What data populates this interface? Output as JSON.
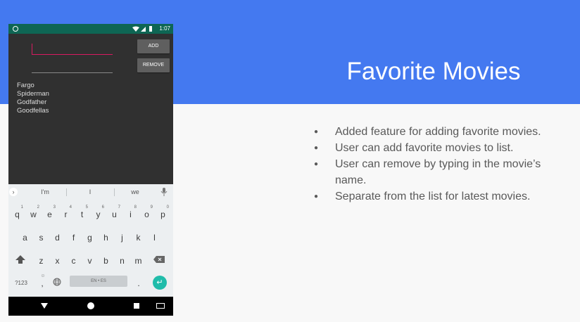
{
  "slide": {
    "title": "Favorite Movies",
    "bullets": [
      "Added feature for adding favorite movies.",
      "User can add favorite movies to list.",
      "User can remove by typing in the movie’s name.",
      "Separate from the list for latest movies."
    ],
    "colors": {
      "header": "#4479f0",
      "background": "#f8f8f8",
      "bullet_text": "#595959"
    }
  },
  "phone": {
    "status": {
      "time": "1:07",
      "icons": [
        "wifi-icon",
        "signal-icon",
        "battery-icon"
      ]
    },
    "app": {
      "add_button": "ADD",
      "remove_button": "REMOVE",
      "add_input_value": "",
      "remove_input_value": "",
      "movies": [
        "Fargo",
        "Spiderman",
        "Godfather",
        "Goodfellas"
      ],
      "colors": {
        "accent": "#d81b60",
        "background": "#303030",
        "button": "#5f5f5f"
      }
    },
    "keyboard": {
      "suggestions": [
        "I'm",
        "I",
        "we"
      ],
      "row1": [
        "q",
        "w",
        "e",
        "r",
        "t",
        "y",
        "u",
        "i",
        "o",
        "p"
      ],
      "row1_hints": [
        "1",
        "2",
        "3",
        "4",
        "5",
        "6",
        "7",
        "8",
        "9",
        "0"
      ],
      "row2": [
        "a",
        "s",
        "d",
        "f",
        "g",
        "h",
        "j",
        "k",
        "l"
      ],
      "row3": [
        "z",
        "x",
        "c",
        "v",
        "b",
        "n",
        "m"
      ],
      "symbols_key": "?123",
      "comma_key": ",",
      "period_key": ".",
      "space_label": "EN • ES",
      "emoji_hint": "☺"
    },
    "nav": {
      "icons": [
        "back-icon",
        "home-icon",
        "recents-icon",
        "keyboard-switch-icon"
      ]
    }
  }
}
